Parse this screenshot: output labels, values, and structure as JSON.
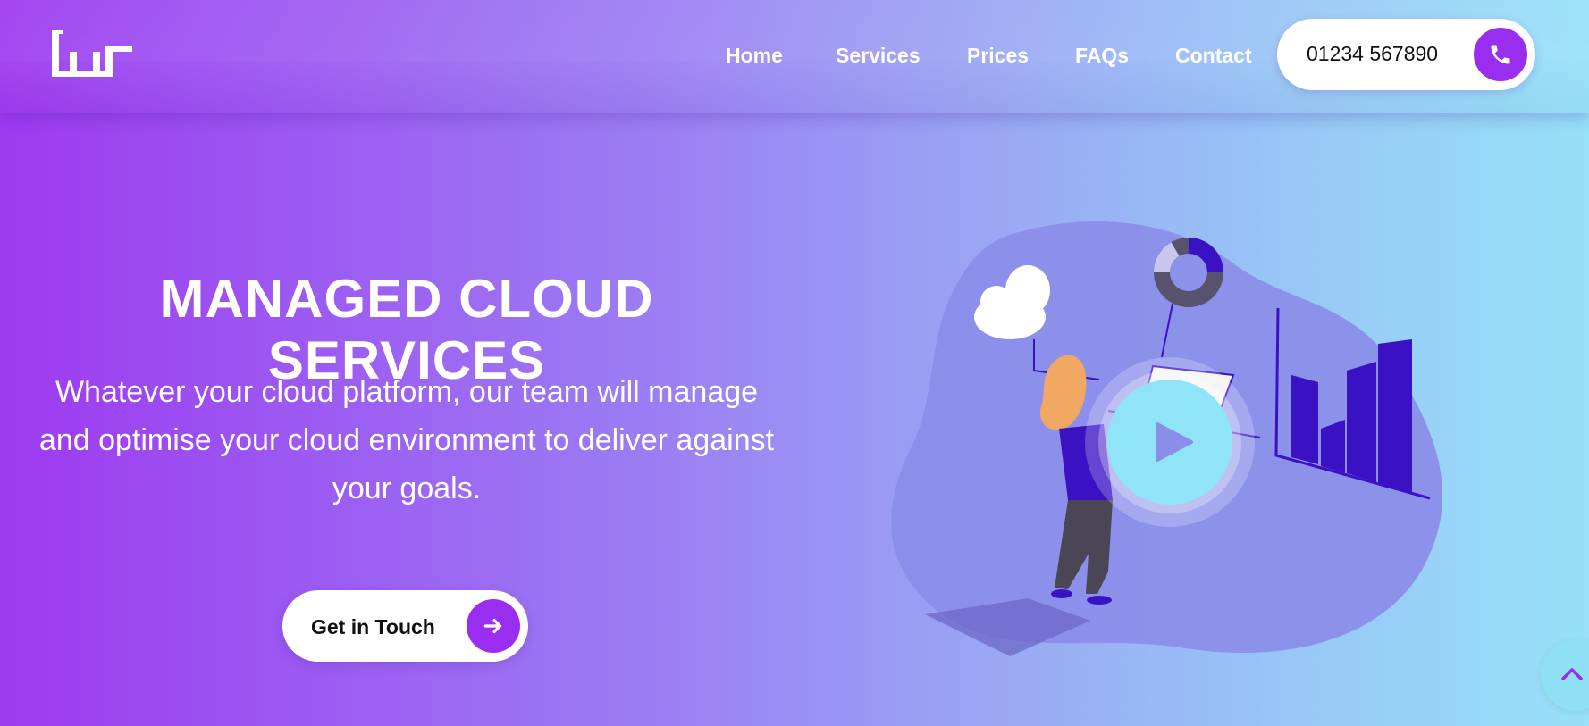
{
  "header": {
    "logo_icon": "brand-logo",
    "nav": [
      {
        "label": "Home"
      },
      {
        "label": "Services"
      },
      {
        "label": "Prices"
      },
      {
        "label": "FAQs"
      },
      {
        "label": "Contact"
      }
    ],
    "phone": {
      "number": "01234 567890",
      "icon": "phone-icon"
    }
  },
  "hero": {
    "title": "MANAGED CLOUD SERVICES",
    "subtitle": "Whatever your cloud platform, our team will manage and optimise your cloud environment to deliver against your goals.",
    "cta_label": "Get in Touch",
    "cta_icon": "arrow-right-icon",
    "play_icon": "play-icon"
  },
  "scroll_top_icon": "chevron-up-icon",
  "colors": {
    "accent": "#9a2ef0",
    "gradient_start": "#9d3af0",
    "gradient_end": "#97e0f8",
    "play_core": "#8fe5f7",
    "chart_bars": "#3a12c4"
  }
}
